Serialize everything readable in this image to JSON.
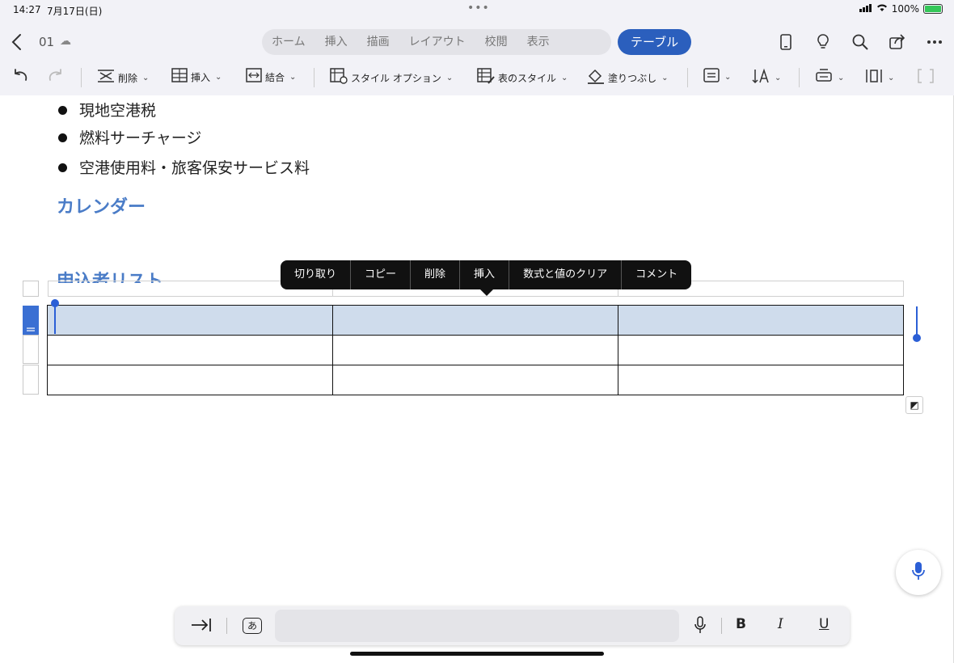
{
  "status_bar": {
    "time": "14:27",
    "date": "7月17日(日)",
    "battery": "100%",
    "accent": "#34c759"
  },
  "header": {
    "doc_name": "01",
    "tabs": [
      "ホーム",
      "挿入",
      "描画",
      "レイアウト",
      "校閲",
      "表示"
    ],
    "active_tab": "テーブル",
    "active_color": "#2b5fbd",
    "icons": [
      "device-icon",
      "lightbulb-icon",
      "search-icon",
      "share-icon",
      "more-icon"
    ]
  },
  "ribbon": {
    "delete": "削除",
    "insert": "挿入",
    "merge": "結合",
    "style_options": "スタイル オプション",
    "table_styles": "表のスタイル",
    "fill": "塗りつぶし"
  },
  "document": {
    "bullets": [
      "現地空港税",
      "燃料サーチャージ",
      "空港使用料・旅客保安サービス料"
    ],
    "heading_calendar": "カレンダー",
    "heading_applicants": "申込者リスト",
    "heading_color": "#4a7cc7"
  },
  "context_menu": {
    "items": [
      "切り取り",
      "コピー",
      "削除",
      "挿入",
      "数式と値のクリア",
      "コメント"
    ]
  },
  "table": {
    "rows": 4,
    "cols": 3,
    "selected_row": 2,
    "selection_color": "#cfdcec"
  },
  "bottom_toolbar": {
    "bold": "B",
    "italic": "I",
    "underline": "U",
    "ime_key": "あ"
  }
}
